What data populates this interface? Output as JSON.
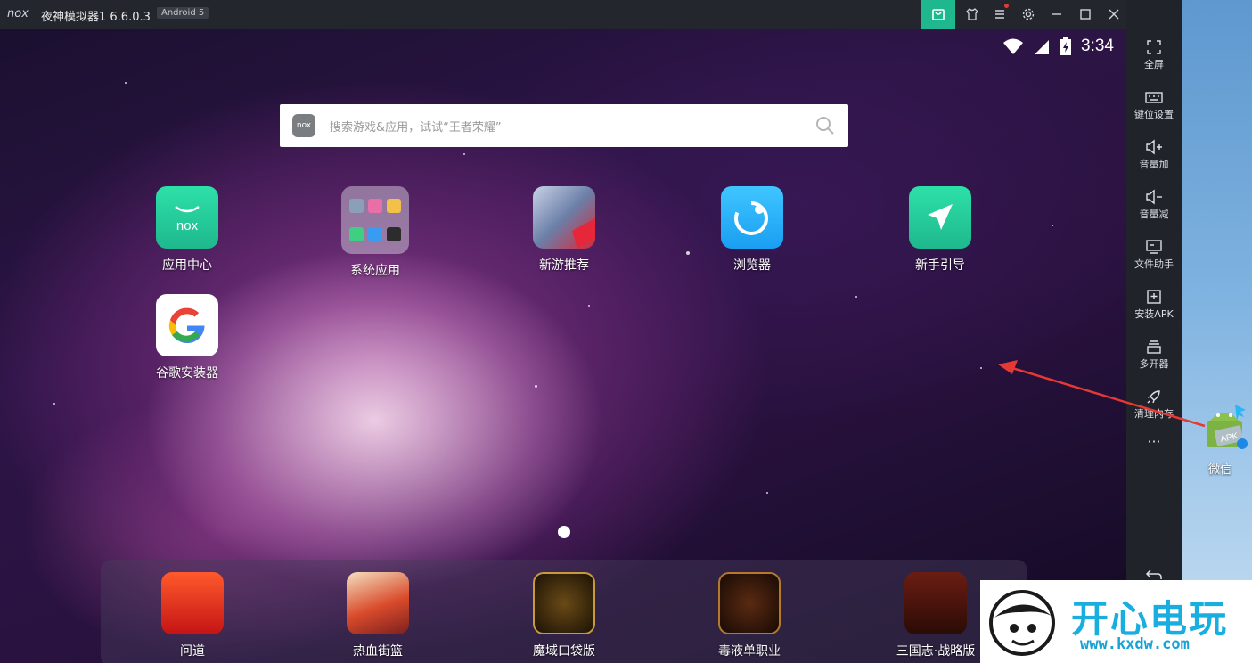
{
  "titlebar": {
    "logo": "nox",
    "title": "夜神模拟器1 6.6.0.3",
    "android_badge": "Android 5"
  },
  "statusbar": {
    "time": "3:34"
  },
  "search": {
    "nox_icon_text": "nox",
    "placeholder": "搜索游戏&应用，试试“王者荣耀”"
  },
  "home_apps": [
    {
      "label": "应用中心"
    },
    {
      "label": "系统应用"
    },
    {
      "label": "新游推荐"
    },
    {
      "label": "浏览器"
    },
    {
      "label": "新手引导"
    },
    {
      "label": "谷歌安装器"
    }
  ],
  "dock_apps": [
    {
      "label": "问道"
    },
    {
      "label": "热血街篮"
    },
    {
      "label": "魔域口袋版"
    },
    {
      "label": "毒液单职业"
    },
    {
      "label": "三国志·战略版"
    }
  ],
  "tools": [
    {
      "label": "全屏"
    },
    {
      "label": "键位设置"
    },
    {
      "label": "音量加"
    },
    {
      "label": "音量减"
    },
    {
      "label": "文件助手"
    },
    {
      "label": "安装APK"
    },
    {
      "label": "多开器"
    },
    {
      "label": "清理内存"
    },
    {
      "label": "···"
    }
  ],
  "desktop": {
    "apk_icon_text": "APK",
    "apk_file_label": "微信"
  },
  "watermark": {
    "brand": "开心电玩",
    "url": "www.kxdw.com"
  },
  "colors": {
    "accent_green": "#1fb88e",
    "titlebar": "#23262d",
    "panel": "#20232a"
  }
}
